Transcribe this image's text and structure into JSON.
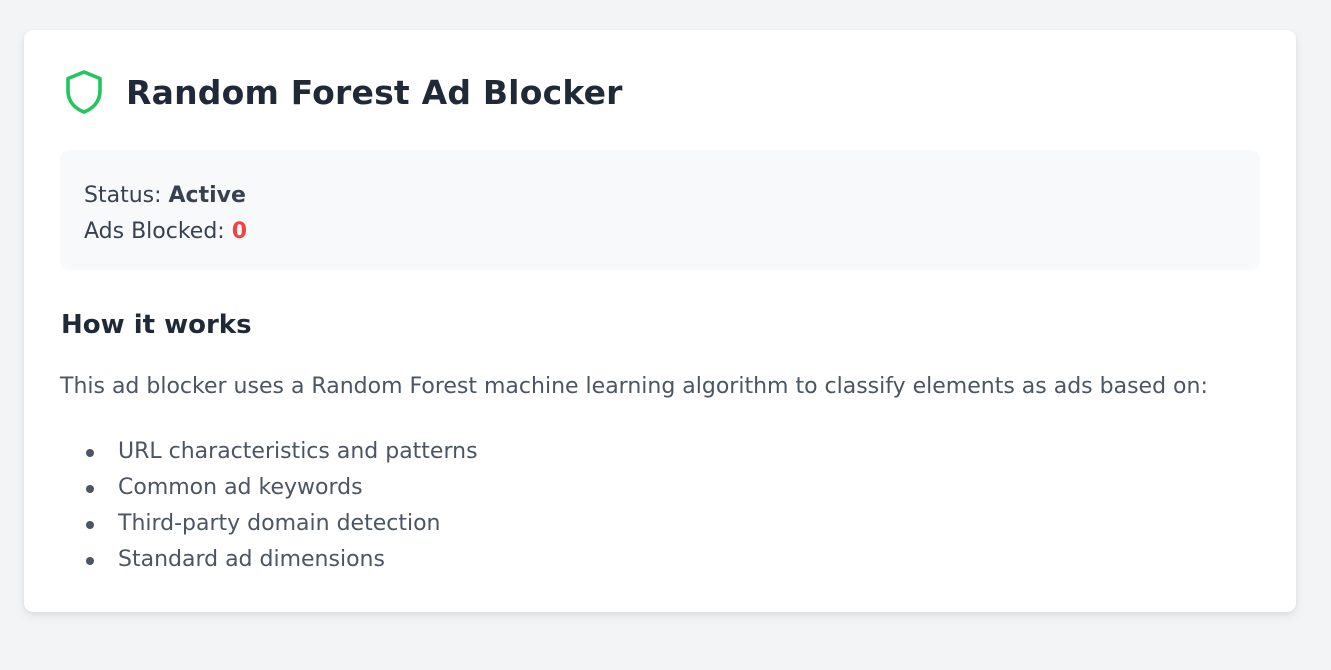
{
  "header": {
    "title": "Random Forest Ad Blocker",
    "icon": "shield-icon"
  },
  "status": {
    "status_label": "Status: ",
    "status_value": "Active",
    "blocked_label": "Ads Blocked: ",
    "blocked_value": "0"
  },
  "how_it_works": {
    "title": "How it works",
    "description": "This ad blocker uses a Random Forest machine learning algorithm to classify elements as ads based on:",
    "features": [
      "URL characteristics and patterns",
      "Common ad keywords",
      "Third-party domain detection",
      "Standard ad dimensions"
    ]
  },
  "colors": {
    "background": "#f3f4f6",
    "card": "#ffffff",
    "status_box": "#f8f9fb",
    "shield_green": "#22c55e",
    "blocked_red": "#ef4444",
    "heading_text": "#1f2937",
    "body_text": "#4b5563"
  }
}
